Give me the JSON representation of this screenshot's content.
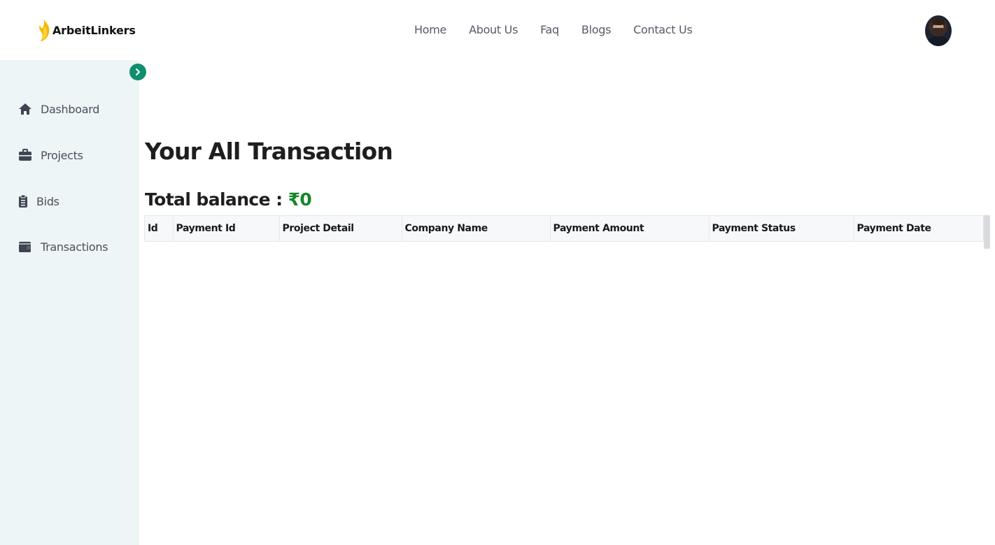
{
  "header": {
    "logo_text": "ArbeitLinkers",
    "nav": [
      {
        "label": "Home"
      },
      {
        "label": "About Us"
      },
      {
        "label": "Faq"
      },
      {
        "label": "Blogs"
      },
      {
        "label": "Contact Us"
      }
    ]
  },
  "sidebar": {
    "items": [
      {
        "label": "Dashboard",
        "icon": "home-icon"
      },
      {
        "label": "Projects",
        "icon": "briefcase-icon"
      },
      {
        "label": "Bids",
        "icon": "clipboard-icon"
      },
      {
        "label": "Transactions",
        "icon": "wallet-icon"
      }
    ]
  },
  "main": {
    "title": "Your All Transaction",
    "balance_label": "Total balance : ",
    "balance_value": "₹0",
    "table": {
      "columns": [
        "Id",
        "Payment Id",
        "Project Detail",
        "Company Name",
        "Payment Amount",
        "Payment Status",
        "Payment Date"
      ],
      "rows": []
    }
  },
  "colors": {
    "accent": "#0f8f6f",
    "balance": "#15862a",
    "sidebar_bg": "#eef5f7",
    "logo_flame": "#f5b800"
  }
}
